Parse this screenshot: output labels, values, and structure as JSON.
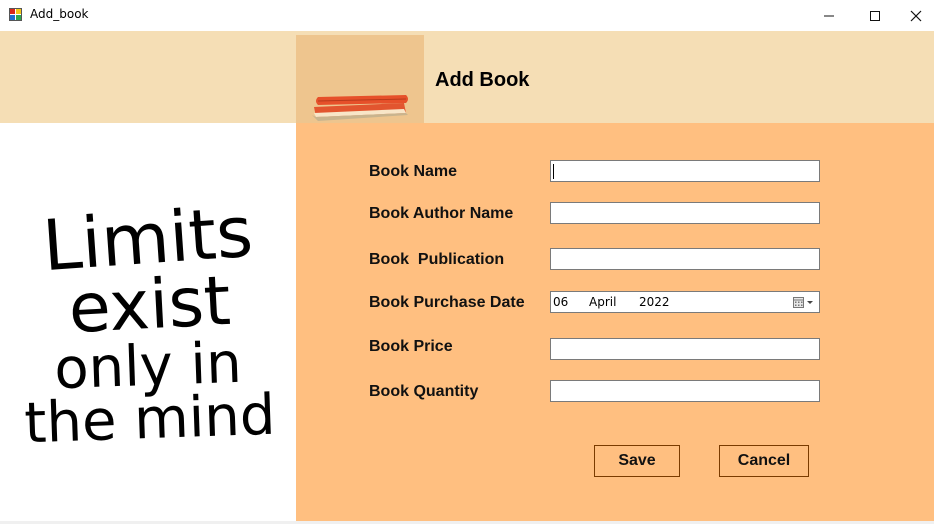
{
  "window": {
    "title": "Add_book",
    "controls": {
      "minimize": "—",
      "maximize": "☐",
      "close": "✕"
    }
  },
  "header": {
    "title": "Add Book",
    "image_icon": "stacked-books-icon"
  },
  "quote": {
    "lines": [
      "Limits",
      "exist",
      "only in",
      "the mind"
    ]
  },
  "form": {
    "fields": [
      {
        "label": "Book Name",
        "value": "",
        "focused": true
      },
      {
        "label": "Book Author Name",
        "value": ""
      },
      {
        "label": "Book  Publication",
        "value": ""
      },
      {
        "label": "Book Purchase Date",
        "date": {
          "day": "06",
          "month": "April",
          "year": "2022"
        },
        "icon": "calendar-dropdown-icon"
      },
      {
        "label": "Book Price",
        "value": ""
      },
      {
        "label": "Book Quantity",
        "value": ""
      }
    ],
    "buttons": {
      "save": "Save",
      "cancel": "Cancel"
    }
  },
  "colors": {
    "header_bg": "#f5deb5",
    "form_bg": "#ffbf80",
    "image_bg": "#eec58e",
    "book_red": "#e2552f",
    "button_border": "#7a3b00"
  }
}
